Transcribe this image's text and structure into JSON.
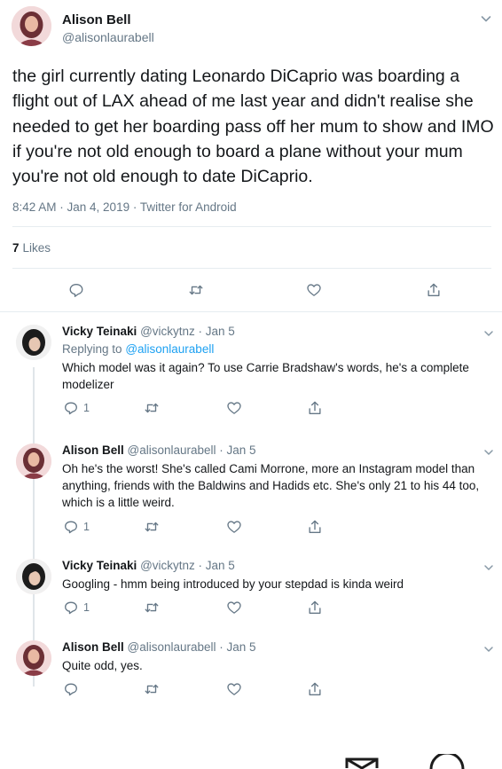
{
  "main_tweet": {
    "author_name": "Alison Bell",
    "author_handle": "@alisonlaurabell",
    "text": "the girl currently dating Leonardo DiCaprio was boarding a flight out of LAX ahead of me last year and didn't realise she needed to get her boarding pass off her mum to show and IMO if you're not old enough to board a plane without your mum you're not old enough to date DiCaprio.",
    "meta": "8:42 AM · Jan 4, 2019 · Twitter for Android",
    "likes_count": "7",
    "likes_label": "Likes",
    "icons": [
      "reply-icon",
      "retweet-icon",
      "like-icon",
      "share-icon",
      "chevron-down-icon"
    ]
  },
  "replies": [
    {
      "author_name": "Vicky Teinaki",
      "author_handle": "@vickytnz · Jan 5",
      "replying_prefix": "Replying to",
      "replying_handle": "@alisonlaurabell",
      "text": "Which model was it again? To use Carrie Bradshaw's words, he's a complete modelizer",
      "reply_count": "1"
    },
    {
      "author_name": "Alison Bell",
      "author_handle": "@alisonlaurabell · Jan 5",
      "text": "Oh he's the worst! She's called Cami Morrone, more an Instagram model than anything, friends with the Baldwins and Hadids etc. She's only 21 to his 44 too, which is a little weird.",
      "reply_count": "1"
    },
    {
      "author_name": "Vicky Teinaki",
      "author_handle": "@vickytnz · Jan 5",
      "text": "Googling - hmm being introduced by your stepdad is kinda weird",
      "reply_count": "1"
    },
    {
      "author_name": "Alison Bell",
      "author_handle": "@alisonlaurabell · Jan 5",
      "text": "Quite odd, yes."
    }
  ],
  "colors": {
    "text": "#14171a",
    "secondary": "#657786",
    "link": "#1da1f2",
    "border": "#e6ecf0"
  }
}
